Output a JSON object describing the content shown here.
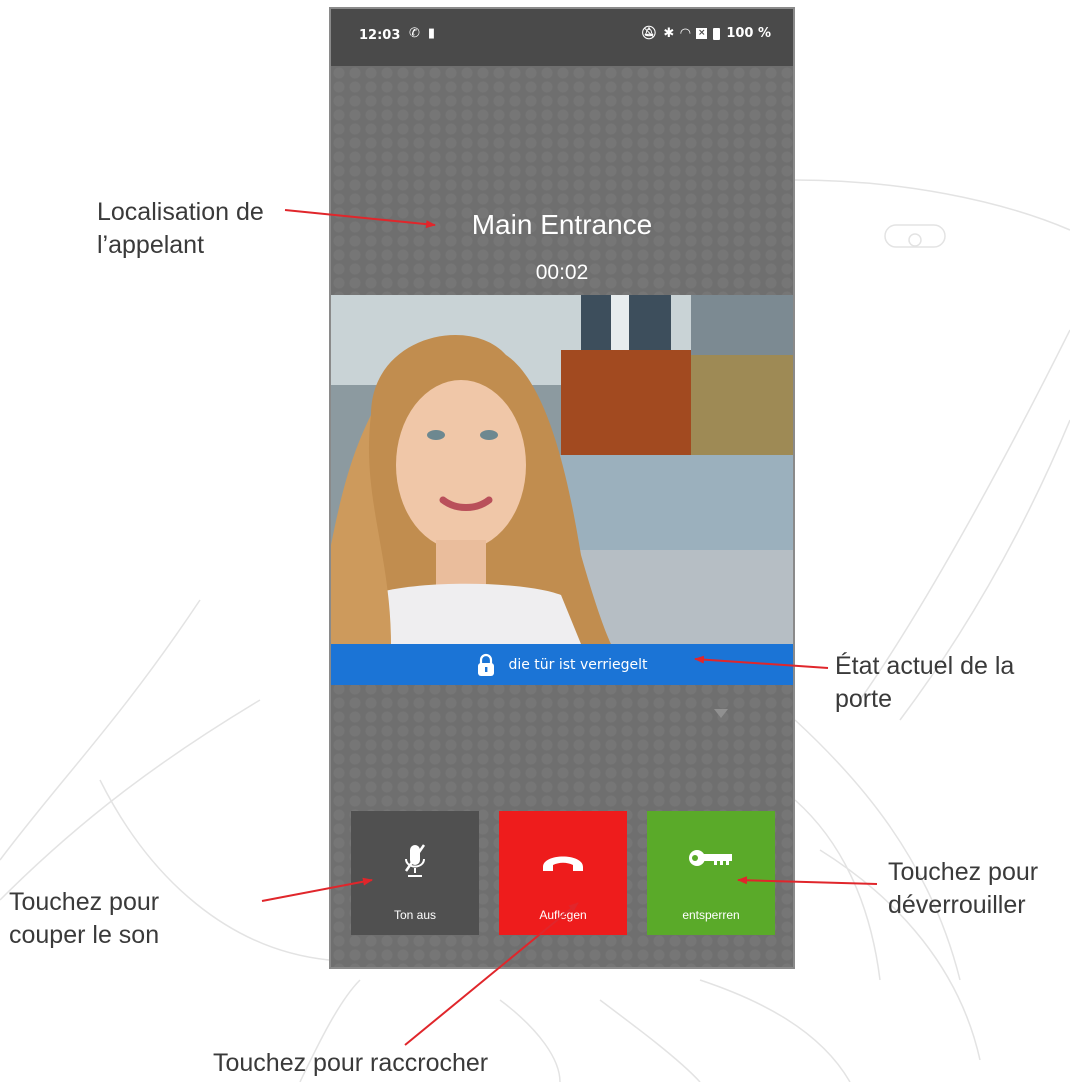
{
  "status_bar": {
    "time": "12:03",
    "battery_percent": "100 %",
    "left_icons": [
      "call-icon",
      "keyhole-icon"
    ],
    "right_icons": [
      "mute-bell-icon",
      "bluetooth-icon",
      "wifi-icon",
      "sim-icon",
      "battery-icon"
    ]
  },
  "call": {
    "caller_location": "Main Entrance",
    "timer": "00:02"
  },
  "door_status": {
    "text": "die tür ist verriegelt",
    "icon": "lock-icon",
    "color": "#1b74d6"
  },
  "actions": [
    {
      "label": "Ton aus",
      "icon": "mic-off-icon",
      "color": "#505050"
    },
    {
      "label": "Auflegen",
      "icon": "hang-up-icon",
      "color": "#ee1c1c"
    },
    {
      "label": "entsperren",
      "icon": "key-icon",
      "color": "#5aaa29"
    }
  ],
  "annotations": {
    "caller_location_line1": "Localisation de",
    "caller_location_line2": "l’appelant",
    "door_state_line1": "État actuel de la",
    "door_state_line2": "porte",
    "mute_line1": "Touchez pour",
    "mute_line2": "couper le son",
    "hangup": "Touchez pour raccrocher",
    "unlock_line1": "Touchez pour",
    "unlock_line2": "déverrouiller"
  },
  "colors": {
    "arrow": "#e0262b",
    "phone_background": "#6f6f6f",
    "status_bar": "#4a4a4a"
  }
}
